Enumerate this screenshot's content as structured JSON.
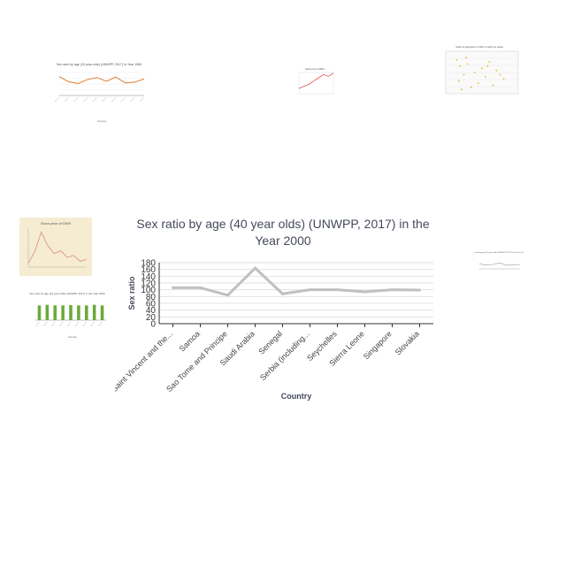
{
  "chart_data": {
    "type": "line",
    "title": "Sex ratio by age (40 year olds) (UNWPP, 2017) in the Year 2000",
    "xlabel": "Country",
    "ylabel": "Sex ratio",
    "categories": [
      "Saint Vincent and the...",
      "Samoa",
      "Sao Tome and Principe",
      "Saudi Arabia",
      "Senegal",
      "Serbia (including...",
      "Seychelles",
      "Sierra Leone",
      "Singapore",
      "Slovakia"
    ],
    "values": [
      106,
      106,
      84,
      164,
      88,
      100,
      100,
      94,
      100,
      99
    ],
    "ylim": [
      0,
      180
    ],
    "yticks": [
      "0",
      "20",
      "40",
      "60",
      "80",
      "100",
      "120",
      "140",
      "160",
      "180"
    ],
    "line_color": "#c0c0c0",
    "grid": true
  },
  "thumbnails": {
    "top_left_title": "Sex ratio by age (15 year olds) (UNWPP, 2017) in Year 1960",
    "top_left_xlabel": "Country",
    "top_left_values": [
      82,
      60,
      52,
      70,
      78,
      62,
      80,
      55,
      58,
      72
    ],
    "top_left_color": "#e07b2e",
    "top_center_title": "Stock price of BNS",
    "top_center_values": [
      20,
      28,
      35,
      48,
      60,
      72,
      66,
      78
    ],
    "top_center_color": "#e05050",
    "top_right_title": "Share of agriculture in GDP vs GDP per capita",
    "top_right_color": "#e8b830",
    "left_mid_title": "Stock price of DMS",
    "left_mid_values": [
      10,
      40,
      90,
      55,
      35,
      42,
      25,
      30,
      15,
      20
    ],
    "left_mid_color": "#d98a8a",
    "left_bottom_title": "Sex ratio by age (15 year olds) (UNWPP, 2017) in the Year 2000",
    "left_bottom_xlabel": "Country",
    "left_bottom_values": [
      50,
      52,
      50,
      50,
      51,
      50,
      50,
      52,
      50
    ],
    "left_bottom_color": "#6aaa3a",
    "right_mid_title": "Sex ratio by age (15 year olds) (UNWPP, 2017) in the Year 2000",
    "right_mid_values": [
      52,
      50,
      51,
      53,
      50,
      50,
      51
    ]
  }
}
